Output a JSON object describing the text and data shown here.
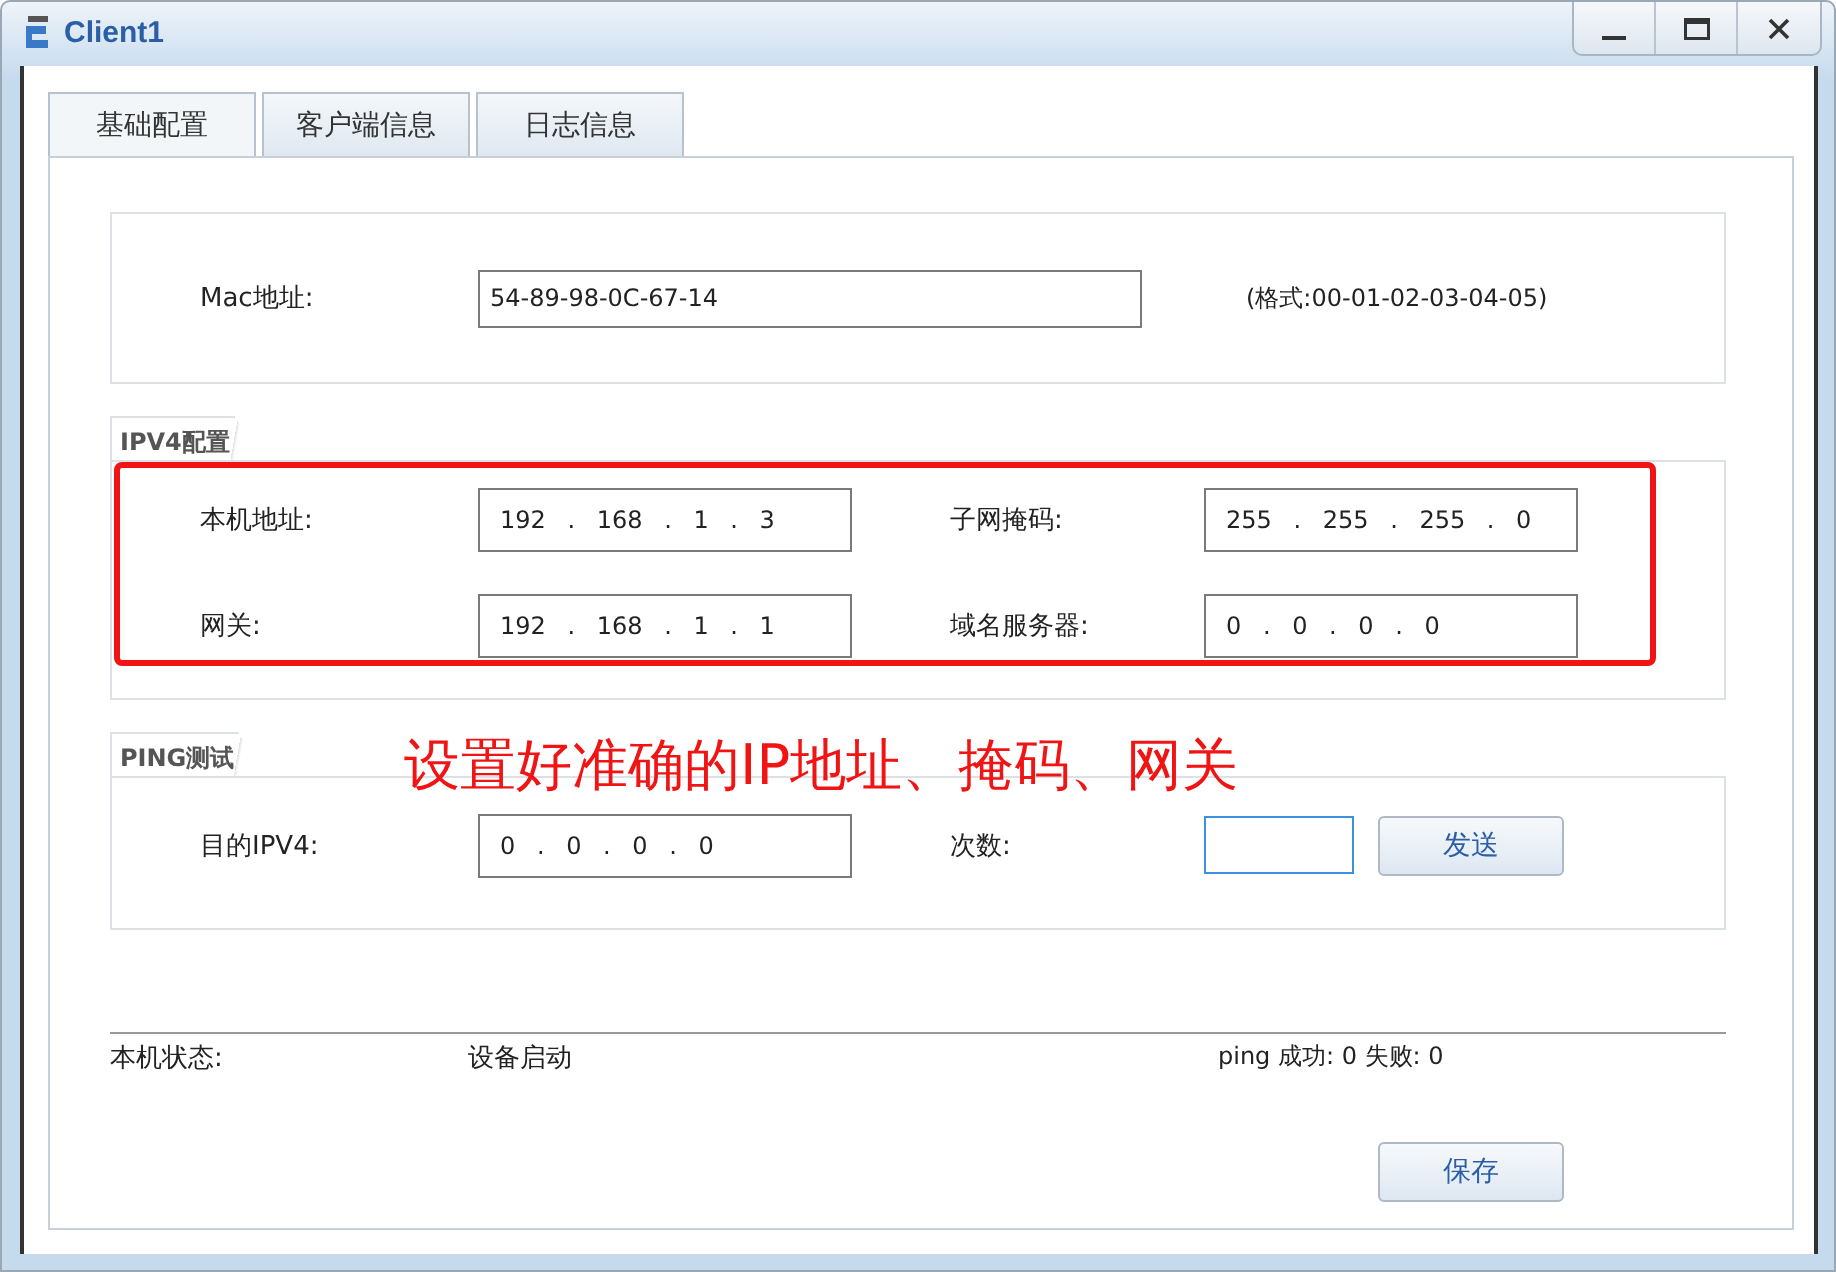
{
  "window": {
    "title": "Client1"
  },
  "tabs": [
    {
      "label": "基础配置",
      "selected": true
    },
    {
      "label": "客户端信息",
      "selected": false
    },
    {
      "label": "日志信息",
      "selected": false
    }
  ],
  "mac": {
    "label": "Mac地址:",
    "value": "54-89-98-0C-67-14",
    "hint": "(格式:00-01-02-03-04-05)"
  },
  "ipv4": {
    "title": "IPV4配置",
    "fields": [
      {
        "label": "本机地址:",
        "value": "192 . 168 . 1 . 3"
      },
      {
        "label": "子网掩码:",
        "value": "255 . 255 . 255 . 0"
      },
      {
        "label": "网关:",
        "value": "192 . 168 . 1 . 1"
      },
      {
        "label": "域名服务器:",
        "value": "0 . 0 . 0 . 0"
      }
    ]
  },
  "ping": {
    "title": "PING测试",
    "target_label": "目的IPV4:",
    "target_value": "0 . 0 . 0 . 0",
    "count_label": "次数:",
    "count_field": {
      "focused": true
    },
    "send_button": "发送"
  },
  "status": {
    "label": "本机状态:",
    "value": "设备启动",
    "result": "ping 成功: 0 失败: 0"
  },
  "save_button": "保存",
  "annotation": {
    "text": "设置好准确的IP地址、掩码、网关"
  }
}
